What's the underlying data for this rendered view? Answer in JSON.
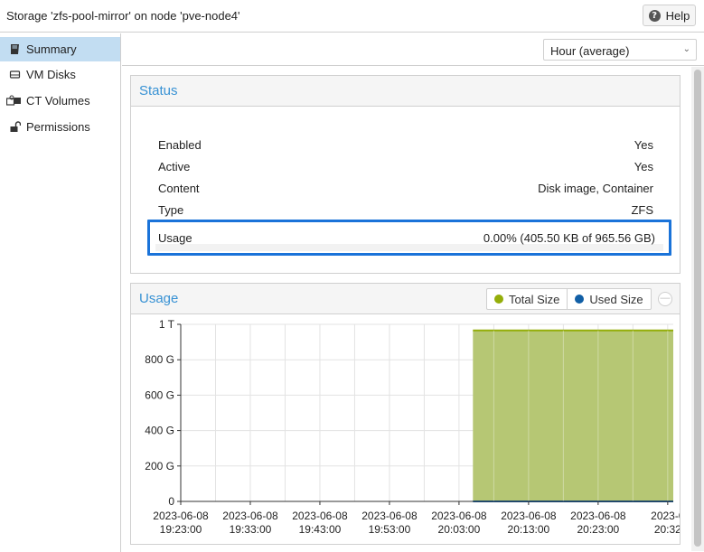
{
  "header": {
    "title": "Storage 'zfs-pool-mirror' on node 'pve-node4'",
    "help_label": "Help",
    "help_icon": "question-circle-icon"
  },
  "sidebar": {
    "items": [
      {
        "label": "Summary",
        "icon": "book-icon",
        "active": true
      },
      {
        "label": "VM Disks",
        "icon": "hdd-icon",
        "active": false
      },
      {
        "label": "CT Volumes",
        "icon": "cubes-icon",
        "active": false
      },
      {
        "label": "Permissions",
        "icon": "unlock-icon",
        "active": false
      }
    ]
  },
  "toolbar": {
    "timeframe_value": "Hour (average)"
  },
  "status": {
    "title": "Status",
    "rows": [
      {
        "key": "Enabled",
        "value": "Yes"
      },
      {
        "key": "Active",
        "value": "Yes"
      },
      {
        "key": "Content",
        "value": "Disk image, Container"
      },
      {
        "key": "Type",
        "value": "ZFS"
      }
    ],
    "usage": {
      "key": "Usage",
      "value": "0.00% (405.50 KB of 965.56 GB)",
      "fraction": 4e-07
    }
  },
  "usage_chart": {
    "title": "Usage",
    "legend": [
      {
        "label": "Total Size",
        "color": "#94ae0a"
      },
      {
        "label": "Used Size",
        "color": "#115fa6"
      }
    ],
    "collapse_symbol": "—"
  },
  "colors": {
    "accent": "#3892d4",
    "highlight_border": "#1a73d9",
    "selected_nav": "#c2ddf2",
    "area_fill": "#b6c774",
    "area_line": "#94ae0a"
  },
  "chart_data": {
    "type": "area",
    "title": "Usage",
    "xlabel": "",
    "ylabel": "",
    "y_ticks": [
      "0",
      "200 G",
      "400 G",
      "600 G",
      "800 G",
      "1 T"
    ],
    "y_tick_values": [
      0,
      200,
      400,
      600,
      800,
      1000
    ],
    "ylim": [
      0,
      1000
    ],
    "x_ticks": [
      {
        "date": "2023-06-08",
        "time": "19:23:00",
        "t": 0
      },
      {
        "date": "2023-06-08",
        "time": "19:33:00",
        "t": 10
      },
      {
        "date": "2023-06-08",
        "time": "19:43:00",
        "t": 20
      },
      {
        "date": "2023-06-08",
        "time": "19:53:00",
        "t": 30
      },
      {
        "date": "2023-06-08",
        "time": "20:03:00",
        "t": 40
      },
      {
        "date": "2023-06-08",
        "time": "20:13:00",
        "t": 50
      },
      {
        "date": "2023-06-08",
        "time": "20:23:00",
        "t": 60
      },
      {
        "date": "2023-0",
        "time": "20:32",
        "t": 70
      }
    ],
    "xlim": [
      0,
      70.8
    ],
    "grid": true,
    "legend_placement": "top-right",
    "series": [
      {
        "name": "Total Size",
        "start": 42,
        "end": 70.8,
        "value": 965.56
      },
      {
        "name": "Used Size",
        "start": 42,
        "end": 70.8,
        "value": 0.0004
      }
    ]
  }
}
